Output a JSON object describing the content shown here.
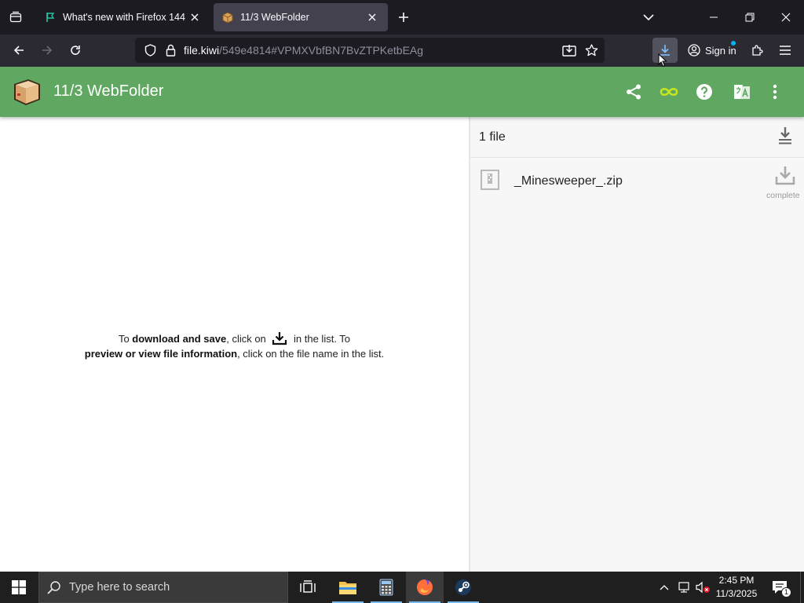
{
  "browser": {
    "tabs": [
      {
        "title": "What's new with Firefox 144",
        "active": false
      },
      {
        "title": "11/3 WebFolder",
        "active": true
      }
    ],
    "url": {
      "host": "file.kiwi",
      "rest": "/549e4814#VPMXVbfBN7BvZTPKetbEAg"
    },
    "signin_label": "Sign in"
  },
  "app": {
    "title": "11/3 WebFolder",
    "colors": {
      "header": "#60a862",
      "infinity": "#c8e61e"
    }
  },
  "hint": {
    "line1_pre": "To ",
    "line1_bold": "download and save",
    "line1_mid": ", click on ",
    "line1_post": " in the list. To",
    "line2_bold": "preview or view file information",
    "line2_post": ", click on the file name in the list."
  },
  "files": {
    "count_label": "1 file",
    "items": [
      {
        "name": "_Minesweeper_.zip",
        "status": "complete"
      }
    ]
  },
  "taskbar": {
    "search_placeholder": "Type here to search",
    "time": "2:45 PM",
    "date": "11/3/2025",
    "notification_count": "1"
  }
}
